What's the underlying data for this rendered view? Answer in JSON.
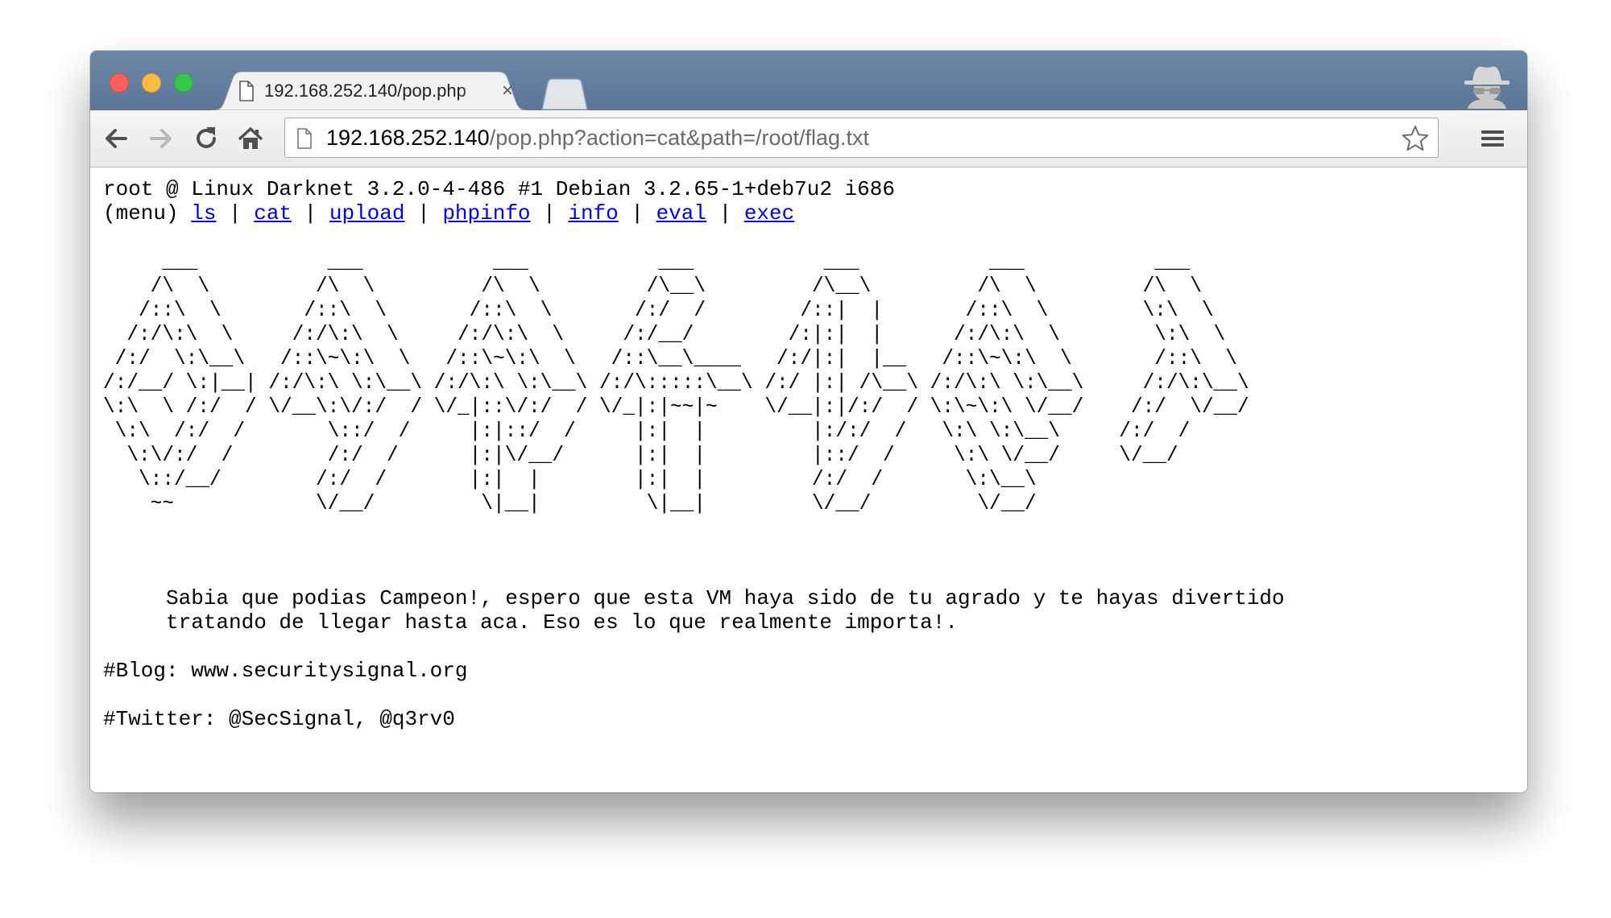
{
  "browser": {
    "tab": {
      "title": "192.168.252.140/pop.php",
      "close_glyph": "×"
    },
    "url": {
      "host": "192.168.252.140",
      "path": "/pop.php?action=cat&path=/root/flag.txt"
    },
    "icons": {
      "back": "back-arrow-icon",
      "forward": "forward-arrow-icon",
      "reload": "reload-icon",
      "home": "home-icon",
      "page": "document-icon",
      "bookmark": "star-icon",
      "menu": "hamburger-menu-icon",
      "incognito": "incognito-icon"
    },
    "colors": {
      "titlebar": "#5f7a9b",
      "link": "#0000ee",
      "close": "#fc605c",
      "minimize": "#fdbc40",
      "zoom": "#34c84a"
    }
  },
  "page": {
    "system_line": "root @ Linux Darknet 3.2.0-4-486 #1 Debian 3.2.65-1+deb7u2 i686",
    "menu": {
      "prefix": "(menu) ",
      "separator": " | ",
      "items": [
        "ls",
        "cat",
        "upload",
        "phpinfo",
        "info",
        "eval",
        "exec"
      ]
    },
    "ascii_art": [
      "     ___           ___           ___           ___           ___           ___           ___",
      "    /\\  \\         /\\  \\         /\\  \\         /\\__\\         /\\__\\         /\\  \\         /\\  \\",
      "   /::\\  \\       /::\\  \\       /::\\  \\       /:/  /        /::|  |       /::\\  \\        \\:\\  \\",
      "  /:/\\:\\  \\     /:/\\:\\  \\     /:/\\:\\  \\     /:/__/        /:|:|  |      /:/\\:\\  \\        \\:\\  \\",
      " /:/  \\:\\__\\   /::\\~\\:\\  \\   /::\\~\\:\\  \\   /::\\__\\____   /:/|:|  |__   /::\\~\\:\\  \\       /::\\  \\",
      "/:/__/ \\:|__| /:/\\:\\ \\:\\__\\ /:/\\:\\ \\:\\__\\ /:/\\:::::\\__\\ /:/ |:| /\\__\\ /:/\\:\\ \\:\\__\\     /:/\\:\\__\\",
      "\\:\\  \\ /:/  / \\/__\\:\\/:/  / \\/_|::\\/:/  / \\/_|:|~~|~    \\/__|:|/:/  / \\:\\~\\:\\ \\/__/    /:/  \\/__/",
      " \\:\\  /:/  /       \\::/  /     |:|::/  /     |:|  |         |:/:/  /   \\:\\ \\:\\__\\     /:/  /",
      "  \\:\\/:/  /        /:/  /      |:|\\/__/      |:|  |         |::/  /     \\:\\ \\/__/     \\/__/",
      "   \\::/__/        /:/  /       |:|  |        |:|  |         /:/  /       \\:\\__\\",
      "    ~~            \\/__/         \\|__|         \\|__|         \\/__/         \\/__/"
    ],
    "message_lines": [
      "Sabia que podias Campeon!, espero que esta VM haya sido de tu agrado y te hayas divertido",
      "tratando de llegar hasta aca. Eso es lo que realmente importa!."
    ],
    "blog_line": "#Blog: www.securitysignal.org",
    "twitter_line": "#Twitter: @SecSignal, @q3rv0"
  }
}
